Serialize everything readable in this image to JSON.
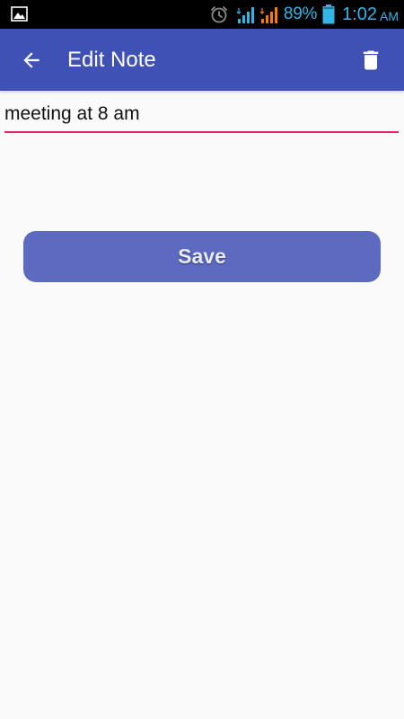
{
  "status_bar": {
    "battery_percent": "89%",
    "time": "1:02",
    "ampm": "AM",
    "icons": [
      "image-icon",
      "alarm-icon",
      "signal-icon",
      "signal-icon",
      "battery-icon"
    ]
  },
  "app_bar": {
    "title": "Edit Note",
    "back_icon": "arrow-left-icon",
    "delete_icon": "trash-icon",
    "background_color": "#3f51b5"
  },
  "note": {
    "value": "meeting at 8 am",
    "underline_color": "#e91e63"
  },
  "save_button": {
    "label": "Save",
    "background_color": "#5c6bc0"
  }
}
